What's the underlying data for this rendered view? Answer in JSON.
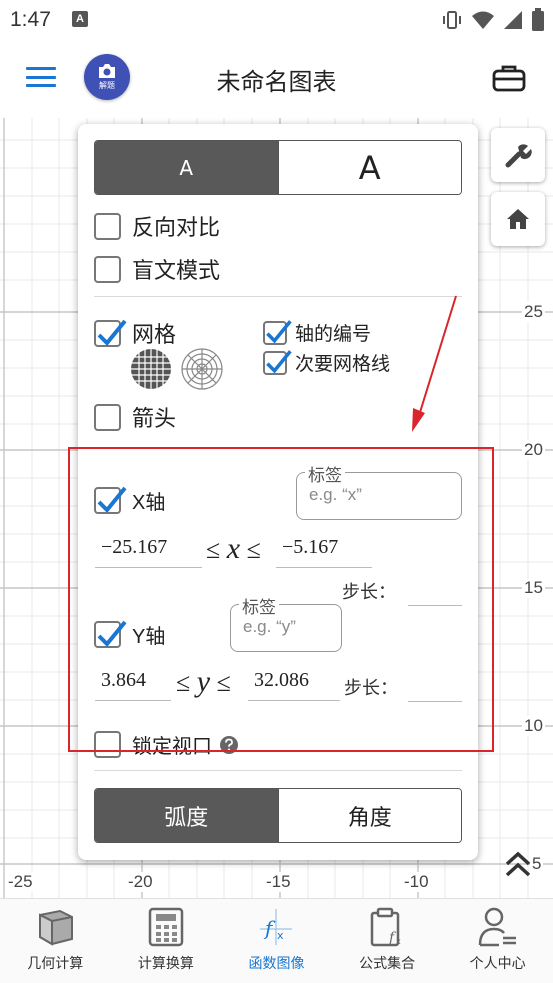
{
  "status_bar": {
    "time": "1:47",
    "notification_letter": "A"
  },
  "app_bar": {
    "title": "未命名图表",
    "camera_label": "解题"
  },
  "graph": {
    "y_ticks": [
      "25",
      "20",
      "15",
      "10",
      "5"
    ],
    "x_ticks": [
      "-25",
      "-20",
      "-15",
      "-10"
    ]
  },
  "panel": {
    "font_size": {
      "small": "A",
      "large": "A"
    },
    "reverse_contrast": "反向对比",
    "braille_mode": "盲文模式",
    "grid": "网格",
    "axis_numbers": "轴的编号",
    "minor_gridlines": "次要网格线",
    "arrows": "箭头",
    "x_axis": "X轴",
    "x_label_legend": "标签",
    "x_label_placeholder": "e.g. “x”",
    "x_min": "−25.167",
    "x_var": "x",
    "x_max": "−5.167",
    "step_label": "步长：",
    "y_axis": "Y轴",
    "y_label_legend": "标签",
    "y_label_placeholder": "e.g. “y”",
    "y_min": "3.864",
    "y_var": "y",
    "y_max": "32.086",
    "lock_viewport": "锁定视口",
    "angle_units": {
      "radian": "弧度",
      "degree": "角度"
    }
  },
  "bottom_nav": [
    {
      "label": "几何计算"
    },
    {
      "label": "计算换算"
    },
    {
      "label": "函数图像"
    },
    {
      "label": "公式集合"
    },
    {
      "label": "个人中心"
    }
  ],
  "colors": {
    "accent": "#1976d2",
    "highlight": "#d9252b",
    "camera": "#3f51b5",
    "active_segment": "#595959"
  }
}
